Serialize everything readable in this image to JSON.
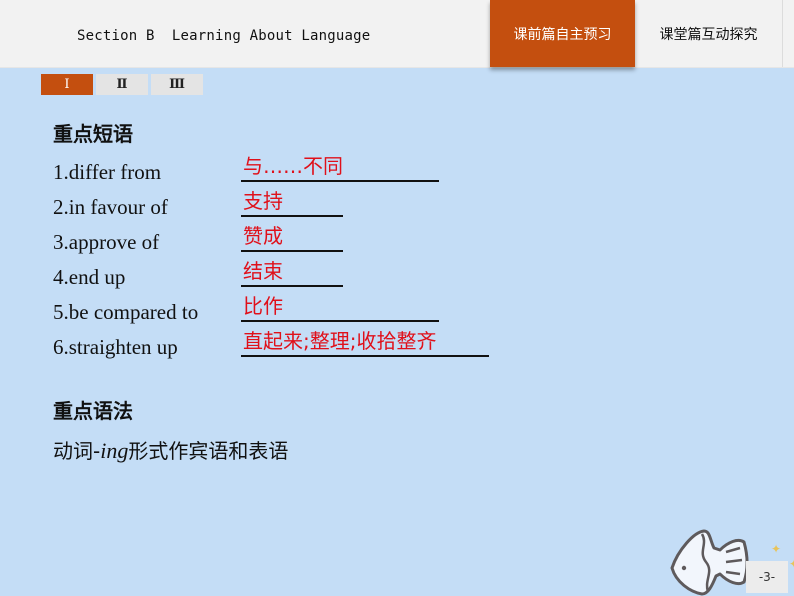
{
  "header": {
    "section_title": "Section B  Learning About Language",
    "tabs": [
      {
        "label": "课前篇自主预习",
        "active": true
      },
      {
        "label": "课堂篇互动探究",
        "active": false
      }
    ]
  },
  "subtabs": [
    {
      "label": "Ⅰ",
      "active": true
    },
    {
      "label": "Ⅱ",
      "active": false
    },
    {
      "label": "Ⅲ",
      "active": false
    }
  ],
  "phrases_section": {
    "heading": "重点短语",
    "items": [
      {
        "phrase": "1.differ from",
        "answer": "与……不同"
      },
      {
        "phrase": "2.in favour of",
        "answer": "支持"
      },
      {
        "phrase": "3.approve of",
        "answer": "赞成"
      },
      {
        "phrase": "4.end up",
        "answer": "结束"
      },
      {
        "phrase": "5.be compared to",
        "answer": "比作"
      },
      {
        "phrase": "6.straighten up",
        "answer": "直起来;整理;收拾整齐"
      }
    ]
  },
  "grammar_section": {
    "heading": "重点语法",
    "text_before": "动词-",
    "text_italic": "ing",
    "text_after": "形式作宾语和表语"
  },
  "footer": {
    "page_number": "-3-",
    "decoration_icon": "fish-icon"
  },
  "colors": {
    "accent": "#c44f0f",
    "answer": "#e0101a",
    "background": "#c4ddf6"
  }
}
